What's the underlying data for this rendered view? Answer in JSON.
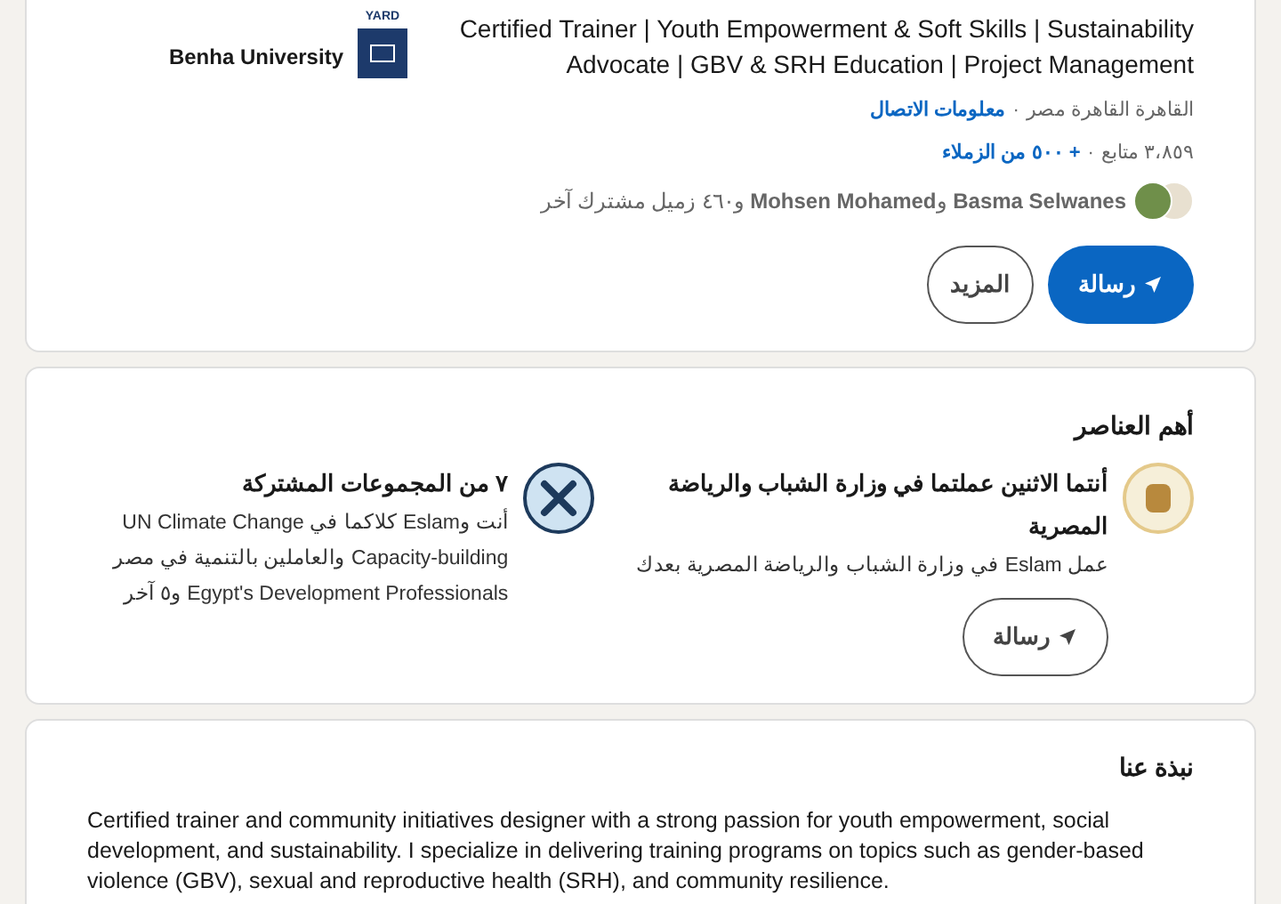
{
  "intro": {
    "headline": "Certified Trainer | Youth Empowerment & Soft Skills | Sustainability Advocate | GBV & SRH Education | Project Management",
    "education": {
      "logo_caption": "YARD",
      "name": "Benha University"
    },
    "location": "القاهرة القاهرة مصر",
    "separator": "·",
    "contact_link": "معلومات الاتصال",
    "followers": "٣،٨٥٩ متابع",
    "connections_link": "+ ٥٠٠ من الزملاء",
    "mutual": "**Basma Selwanes** و**Mohsen Mohamed** و٤٦٠ زميل مشترك آخر",
    "buttons": [
      {
        "kind": "primary",
        "label": "رسالة"
      },
      {
        "kind": "secondary",
        "label": "المزيد"
      }
    ]
  },
  "highlights": {
    "title": "أهم العناصر",
    "items": [
      {
        "kind": "workplace",
        "title": "أنتما الاثنين عملتما في وزارة الشباب والرياضة المصرية",
        "description": "عمل Eslam في وزارة الشباب والرياضة المصرية بعدك",
        "button": "رسالة"
      },
      {
        "kind": "groups",
        "title": "٧  من المجموعات المشتركة",
        "description": "أنت وEslam كلاكما في UN Climate Change Capacity-building والعاملين بالتنمية في مصر Egypt's Development Professionals و٥ آخر"
      }
    ]
  },
  "about": {
    "title": "نبذة عنا",
    "text": "Certified trainer and community initiatives designer with a strong passion for youth empowerment, social development, and sustainability. I specialize in delivering training programs on topics such as gender-based violence (GBV), sexual and reproductive health (SRH), and community resilience."
  }
}
